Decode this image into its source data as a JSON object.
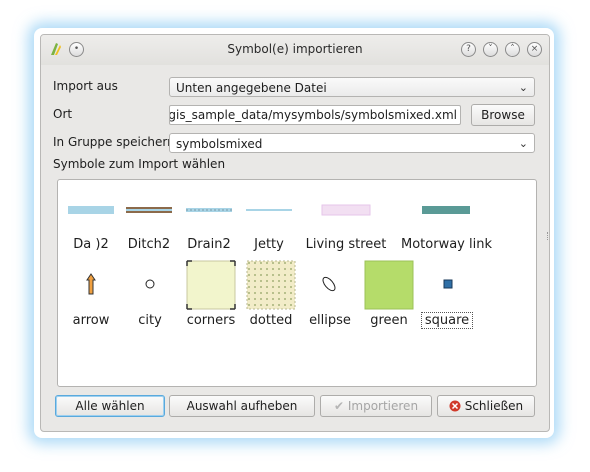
{
  "window": {
    "title": "Symbol(e) importieren"
  },
  "form": {
    "import_from_label": "Import aus",
    "import_from_value": "Unten angegebene Datei",
    "location_label": "Ort",
    "location_value": "/home/qgis/qgis_sample_data/mysymbols/symbolsmixed.xml",
    "browse_label": "Browse",
    "group_label": "In Gruppe speichern",
    "group_value": "symbolsmixed",
    "choose_symbols_label": "Symbole zum Import wählen"
  },
  "symbols": [
    {
      "label": "Da  )2",
      "kind": "line-blue"
    },
    {
      "label": "Ditch2",
      "kind": "line-ditch"
    },
    {
      "label": "Drain2",
      "kind": "line-drain"
    },
    {
      "label": "Jetty",
      "kind": "line-jetty"
    },
    {
      "label": "Living street",
      "kind": "line-living"
    },
    {
      "label": "Motorway link",
      "kind": "line-motorway"
    },
    {
      "label": "arrow",
      "kind": "marker-arrow"
    },
    {
      "label": "city",
      "kind": "marker-circle"
    },
    {
      "label": "corners",
      "kind": "fill-corners"
    },
    {
      "label": "dotted",
      "kind": "fill-dotted"
    },
    {
      "label": "ellipse",
      "kind": "marker-ellipse"
    },
    {
      "label": "green",
      "kind": "fill-green"
    },
    {
      "label": "square",
      "kind": "marker-square"
    }
  ],
  "buttons": {
    "select_all": "Alle wählen",
    "deselect": "Auswahl aufheben",
    "import": "Importieren",
    "close": "Schließen"
  },
  "colors": {
    "accent_focus": "#5aa9dc",
    "green_fill": "#b5dc6a",
    "motorway": "#5a9a96",
    "close_red": "#d03a2a"
  }
}
